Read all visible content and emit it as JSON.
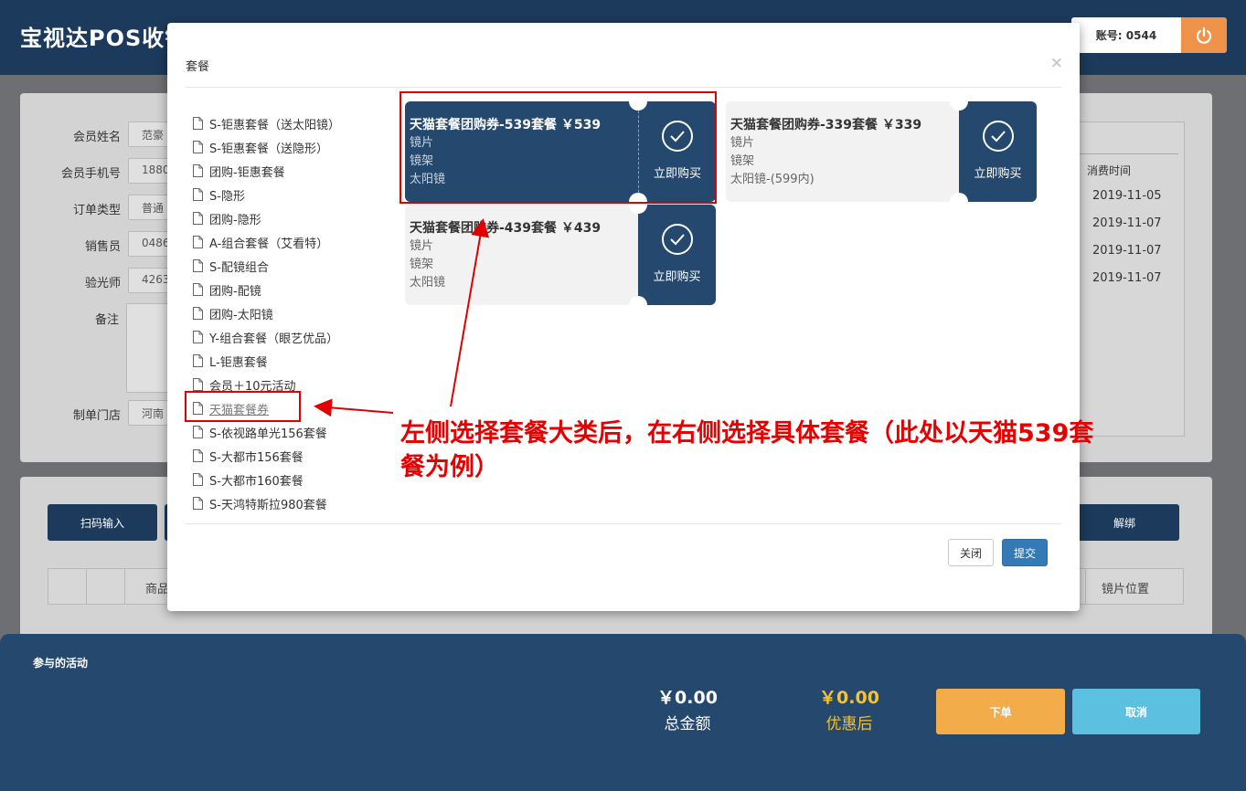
{
  "app": {
    "brand": "宝视达POS收银",
    "account": "账号: 0544"
  },
  "form": {
    "fields": [
      {
        "label": "会员姓名",
        "value": "范豪"
      },
      {
        "label": "会员手机号",
        "value": "1880"
      },
      {
        "label": "订单类型",
        "value": "普通"
      },
      {
        "label": "销售员",
        "value": "0486"
      },
      {
        "label": "验光师",
        "value": "4263"
      }
    ],
    "remark_label": "备注",
    "store_label": "制单门店",
    "store_value": "河南"
  },
  "history": {
    "header": "消费时间",
    "dates": [
      "2019-11-05",
      "2019-11-07",
      "2019-11-07",
      "2019-11-07"
    ]
  },
  "actions": {
    "scan_input": "扫码输入",
    "unbind": "解绑"
  },
  "table": {
    "col_product": "商品",
    "col_lens_position": "镜片位置"
  },
  "bottom": {
    "activity_label": "参与的活动",
    "total_amount": "￥0.00",
    "total_label": "总金额",
    "discount_amount": "￥0.00",
    "discount_label": "优惠后",
    "order_button": "下单",
    "cancel_button": "取消"
  },
  "modal": {
    "title": "套餐",
    "close_symbol": "×",
    "categories": [
      "S-钜惠套餐（送太阳镜）",
      "S-钜惠套餐（送隐形）",
      "团购-钜惠套餐",
      "S-隐形",
      "团购-隐形",
      "A-组合套餐（艾看特）",
      "S-配镜组合",
      "团购-配镜",
      "团购-太阳镜",
      "Y-组合套餐（眼艺优品）",
      "L-钜惠套餐",
      "会员＋10元活动",
      "天猫套餐券",
      "S-依视路单光156套餐",
      "S-大都市156套餐",
      "S-大都市160套餐",
      "S-天鸿特斯拉980套餐"
    ],
    "selected_category_index": 12,
    "packages": [
      {
        "title": "天猫套餐团购券-539套餐 ￥539",
        "items": [
          "镜片",
          "镜架",
          "太阳镜"
        ],
        "buy_label": "立即购买",
        "selected": true
      },
      {
        "title": "天猫套餐团购券-339套餐 ￥339",
        "items": [
          "镜片",
          "镜架",
          "太阳镜-(599内)"
        ],
        "buy_label": "立即购买",
        "selected": false
      },
      {
        "title": "天猫套餐团购券-439套餐 ￥439",
        "items": [
          "镜片",
          "镜架",
          "太阳镜"
        ],
        "buy_label": "立即购买",
        "selected": false
      }
    ],
    "close_button": "关闭",
    "submit_button": "提交"
  },
  "annotation": {
    "text": "左侧选择套餐大类后，在右侧选择具体套餐（此处以天猫539套餐为例）",
    "color": "#e60000"
  },
  "colors": {
    "navy": "#24486e",
    "orange": "#f2ac49",
    "cyan": "#5cc1e0",
    "primary": "#337ab7",
    "discount": "#f5c232"
  }
}
